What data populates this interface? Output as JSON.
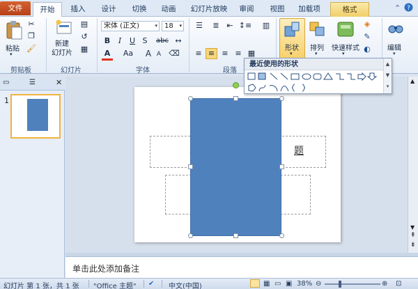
{
  "tabs": {
    "file": "文件",
    "home": "开始",
    "insert": "插入",
    "design": "设计",
    "transitions": "切换",
    "animations": "动画",
    "slideshow": "幻灯片放映",
    "review": "审阅",
    "view": "视图",
    "addins": "加载项",
    "format": "格式"
  },
  "ribbon": {
    "clipboard": {
      "paste": "粘贴",
      "group": "剪贴板"
    },
    "slides": {
      "new_slide_line1": "新建",
      "new_slide_line2": "幻灯片",
      "group": "幻灯片"
    },
    "font": {
      "name": "宋体 (正文)",
      "size": "18",
      "group": "字体",
      "bold": "B",
      "italic": "I",
      "underline": "U",
      "shadow": "S",
      "strike": "abc",
      "fontcolor": "A",
      "case": "Aa"
    },
    "paragraph": {
      "group": "段落"
    },
    "drawing": {
      "shapes": "形状",
      "arrange": "排列",
      "quick_styles": "快速样式"
    },
    "editing": {
      "label": "编辑"
    }
  },
  "gallery": {
    "title": "最近使用的形状"
  },
  "slide_panel": {
    "slide_number": "1"
  },
  "notes": {
    "placeholder": "单击此处添加备注"
  },
  "status": {
    "slide_info": "幻灯片 第 1 张，共 1 张",
    "theme": "\"Office 主题\"",
    "language": "中文(中国)",
    "zoom": "38%"
  },
  "colors": {
    "shape_fill": "#4f81bd",
    "file_tab": "#c44e22",
    "selection": "#f1b33f"
  }
}
